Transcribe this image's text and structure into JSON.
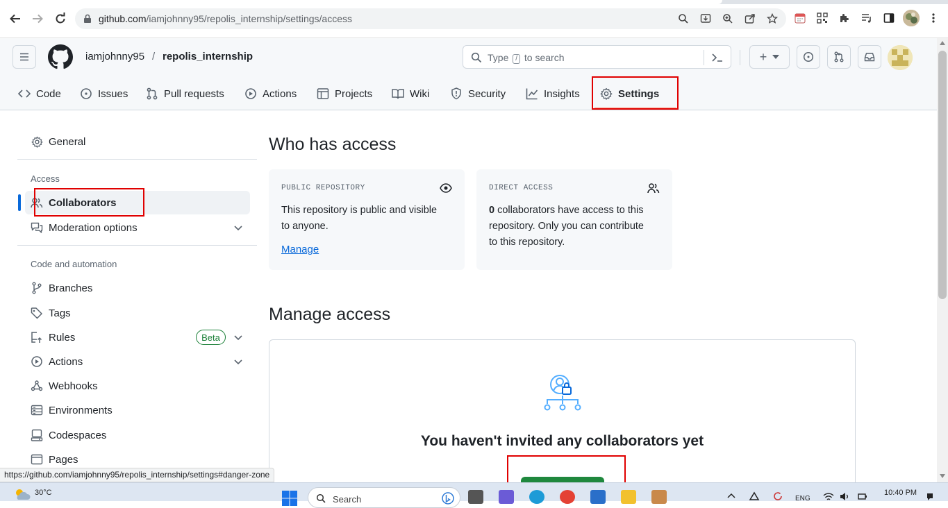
{
  "browser": {
    "url_host": "github.com",
    "url_path": "/iamjohnny95/repolis_internship/settings/access"
  },
  "header": {
    "owner": "iamjohnny95",
    "separator": "/",
    "repo": "repolis_internship",
    "search_prefix": "Type",
    "search_key": "/",
    "search_suffix": "to search",
    "plus_symbol": "+"
  },
  "tabs": [
    {
      "label": "Code",
      "icon": "code-icon"
    },
    {
      "label": "Issues",
      "icon": "issue-icon"
    },
    {
      "label": "Pull requests",
      "icon": "pull-request-icon"
    },
    {
      "label": "Actions",
      "icon": "play-icon"
    },
    {
      "label": "Projects",
      "icon": "table-icon"
    },
    {
      "label": "Wiki",
      "icon": "book-icon"
    },
    {
      "label": "Security",
      "icon": "shield-icon"
    },
    {
      "label": "Insights",
      "icon": "graph-icon"
    },
    {
      "label": "Settings",
      "icon": "gear-icon",
      "selected": true
    }
  ],
  "sidebar": {
    "general": "General",
    "access_heading": "Access",
    "collaborators": "Collaborators",
    "moderation": "Moderation options",
    "code_heading": "Code and automation",
    "branches": "Branches",
    "tags": "Tags",
    "rules": "Rules",
    "beta_badge": "Beta",
    "actions": "Actions",
    "webhooks": "Webhooks",
    "environments": "Environments",
    "codespaces": "Codespaces",
    "pages": "Pages"
  },
  "main": {
    "who_title": "Who has access",
    "public_card": {
      "label": "PUBLIC REPOSITORY",
      "text_line1": "This repository is public and visible",
      "text_line2": "to anyone.",
      "link": "Manage"
    },
    "direct_card": {
      "label": "DIRECT ACCESS",
      "count": "0",
      "text_line1": "collaborators have access to this",
      "text_line2": "repository. Only you can contribute",
      "text_line3": "to this repository."
    },
    "manage_title": "Manage access",
    "empty_title": "You haven't invited any collaborators yet"
  },
  "status_url": "https://github.com/iamjohnny95/repolis_internship/settings#danger-zone",
  "taskbar": {
    "temperature": "30°C",
    "search": "Search",
    "lang": "ENG",
    "time": "10:40 PM"
  },
  "colors": {
    "accent_link": "#0969da",
    "primary_button": "#1f883d",
    "annotation_red": "#e00000"
  }
}
